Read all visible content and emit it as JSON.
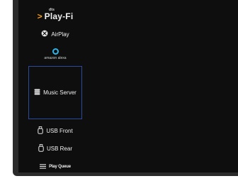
{
  "sources": {
    "playfi": {
      "brand_small": "dts",
      "label": "Play-Fi",
      "icon": "play-fi-arrow-icon",
      "arrow_color": "#f39a1e"
    },
    "airplay": {
      "label": "AirPlay",
      "icon": "airplay-icon"
    },
    "alexa": {
      "label": "amazon alexa",
      "icon": "alexa-ring-icon",
      "ring_color": "#2fb4e6"
    },
    "music_server": {
      "label": "Music Server",
      "icon": "server-icon",
      "selected": true,
      "highlight_color": "#2c4a9c"
    },
    "usb_front": {
      "label": "USB Front",
      "icon": "usb-icon"
    },
    "usb_rear": {
      "label": "USB Rear",
      "icon": "usb-icon"
    },
    "play_queue": {
      "label": "Play Queue",
      "icon": "list-icon"
    }
  },
  "colors": {
    "frame": "#2b2b2b",
    "screen_background": "#0e0e0e",
    "text": "#f0f0f0"
  }
}
